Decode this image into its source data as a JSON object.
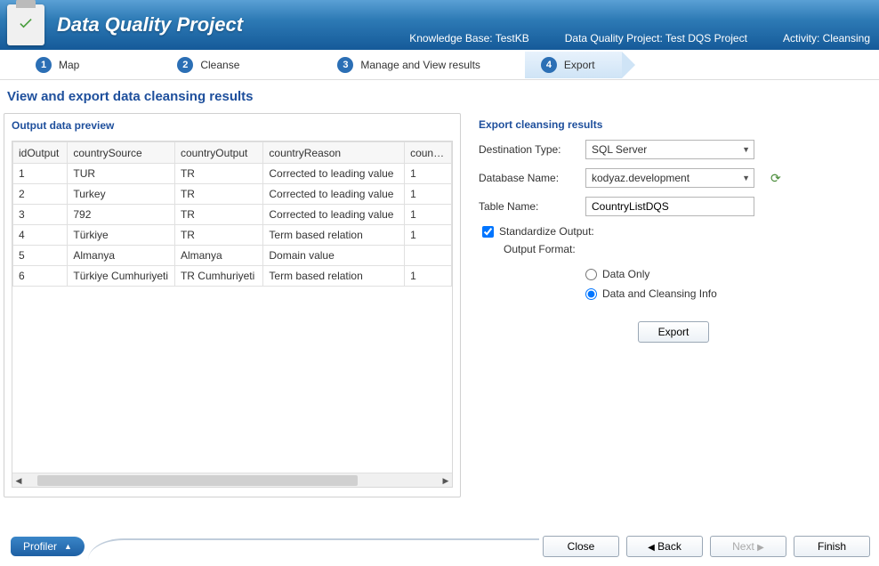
{
  "header": {
    "title": "Data Quality Project",
    "meta": {
      "kb_label": "Knowledge Base:",
      "kb_value": "TestKB",
      "proj_label": "Data Quality Project:",
      "proj_value": "Test DQS Project",
      "act_label": "Activity:",
      "act_value": "Cleansing"
    }
  },
  "steps": [
    {
      "num": "1",
      "label": "Map"
    },
    {
      "num": "2",
      "label": "Cleanse"
    },
    {
      "num": "3",
      "label": "Manage and View results"
    },
    {
      "num": "4",
      "label": "Export"
    }
  ],
  "active_step": 3,
  "page_title": "View and export data cleansing results",
  "preview": {
    "title": "Output data preview",
    "columns": [
      "idOutput",
      "countrySource",
      "countryOutput",
      "countryReason",
      "countryC"
    ],
    "rows": [
      {
        "idOutput": "1",
        "countrySource": "TUR",
        "countryOutput": "TR",
        "countryReason": "Corrected to leading value",
        "c5": "1"
      },
      {
        "idOutput": "2",
        "countrySource": "Turkey",
        "countryOutput": "TR",
        "countryReason": "Corrected to leading value",
        "c5": "1"
      },
      {
        "idOutput": "3",
        "countrySource": "792",
        "countryOutput": "TR",
        "countryReason": "Corrected to leading value",
        "c5": "1"
      },
      {
        "idOutput": "4",
        "countrySource": "Türkiye",
        "countryOutput": "TR",
        "countryReason": "Term based relation",
        "c5": "1"
      },
      {
        "idOutput": "5",
        "countrySource": "Almanya",
        "countryOutput": "Almanya",
        "countryReason": "Domain value",
        "c5": ""
      },
      {
        "idOutput": "6",
        "countrySource": "Türkiye Cumhuriyeti",
        "countryOutput": "TR Cumhuriyeti",
        "countryReason": "Term based relation",
        "c5": "1"
      }
    ]
  },
  "export": {
    "title": "Export cleansing results",
    "dest_label": "Destination Type:",
    "dest_value": "SQL Server",
    "db_label": "Database Name:",
    "db_value": "kodyaz.development",
    "table_label": "Table Name:",
    "table_value": "CountryListDQS",
    "standardize_label": "Standardize Output:",
    "standardize_checked": true,
    "format_label": "Output Format:",
    "radio_data_only": "Data Only",
    "radio_data_info": "Data and Cleansing Info",
    "radio_selected": "info",
    "export_btn": "Export"
  },
  "footer": {
    "profiler": "Profiler",
    "close": "Close",
    "back": "Back",
    "next": "Next",
    "finish": "Finish"
  }
}
